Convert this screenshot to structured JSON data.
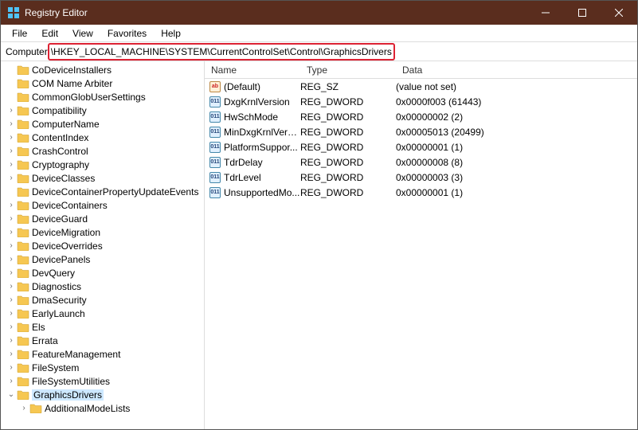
{
  "window": {
    "title": "Registry Editor"
  },
  "menu": [
    "File",
    "Edit",
    "View",
    "Favorites",
    "Help"
  ],
  "address": {
    "label": "Computer",
    "path": "\\HKEY_LOCAL_MACHINE\\SYSTEM\\CurrentControlSet\\Control\\GraphicsDrivers"
  },
  "tree": [
    {
      "label": "CoDeviceInstallers",
      "indent": 0,
      "exp": ""
    },
    {
      "label": "COM Name Arbiter",
      "indent": 0,
      "exp": ""
    },
    {
      "label": "CommonGlobUserSettings",
      "indent": 0,
      "exp": ""
    },
    {
      "label": "Compatibility",
      "indent": 0,
      "exp": "›"
    },
    {
      "label": "ComputerName",
      "indent": 0,
      "exp": "›"
    },
    {
      "label": "ContentIndex",
      "indent": 0,
      "exp": "›"
    },
    {
      "label": "CrashControl",
      "indent": 0,
      "exp": "›"
    },
    {
      "label": "Cryptography",
      "indent": 0,
      "exp": "›"
    },
    {
      "label": "DeviceClasses",
      "indent": 0,
      "exp": "›"
    },
    {
      "label": "DeviceContainerPropertyUpdateEvents",
      "indent": 0,
      "exp": ""
    },
    {
      "label": "DeviceContainers",
      "indent": 0,
      "exp": "›"
    },
    {
      "label": "DeviceGuard",
      "indent": 0,
      "exp": "›"
    },
    {
      "label": "DeviceMigration",
      "indent": 0,
      "exp": "›"
    },
    {
      "label": "DeviceOverrides",
      "indent": 0,
      "exp": "›"
    },
    {
      "label": "DevicePanels",
      "indent": 0,
      "exp": "›"
    },
    {
      "label": "DevQuery",
      "indent": 0,
      "exp": "›"
    },
    {
      "label": "Diagnostics",
      "indent": 0,
      "exp": "›"
    },
    {
      "label": "DmaSecurity",
      "indent": 0,
      "exp": "›"
    },
    {
      "label": "EarlyLaunch",
      "indent": 0,
      "exp": "›"
    },
    {
      "label": "Els",
      "indent": 0,
      "exp": "›"
    },
    {
      "label": "Errata",
      "indent": 0,
      "exp": "›"
    },
    {
      "label": "FeatureManagement",
      "indent": 0,
      "exp": "›"
    },
    {
      "label": "FileSystem",
      "indent": 0,
      "exp": "›"
    },
    {
      "label": "FileSystemUtilities",
      "indent": 0,
      "exp": "›"
    },
    {
      "label": "GraphicsDrivers",
      "indent": 0,
      "exp": "⌄",
      "selected": true
    },
    {
      "label": "AdditionalModeLists",
      "indent": 1,
      "exp": "›"
    }
  ],
  "list": {
    "headers": {
      "name": "Name",
      "type": "Type",
      "data": "Data"
    },
    "rows": [
      {
        "icon": "sz",
        "name": "(Default)",
        "type": "REG_SZ",
        "data": "(value not set)"
      },
      {
        "icon": "dw",
        "name": "DxgKrnlVersion",
        "type": "REG_DWORD",
        "data": "0x0000f003 (61443)"
      },
      {
        "icon": "dw",
        "name": "HwSchMode",
        "type": "REG_DWORD",
        "data": "0x00000002 (2)"
      },
      {
        "icon": "dw",
        "name": "MinDxgKrnlVersi...",
        "type": "REG_DWORD",
        "data": "0x00005013 (20499)"
      },
      {
        "icon": "dw",
        "name": "PlatformSuppor...",
        "type": "REG_DWORD",
        "data": "0x00000001 (1)"
      },
      {
        "icon": "dw",
        "name": "TdrDelay",
        "type": "REG_DWORD",
        "data": "0x00000008 (8)"
      },
      {
        "icon": "dw",
        "name": "TdrLevel",
        "type": "REG_DWORD",
        "data": "0x00000003 (3)"
      },
      {
        "icon": "dw",
        "name": "UnsupportedMo...",
        "type": "REG_DWORD",
        "data": "0x00000001 (1)"
      }
    ]
  }
}
